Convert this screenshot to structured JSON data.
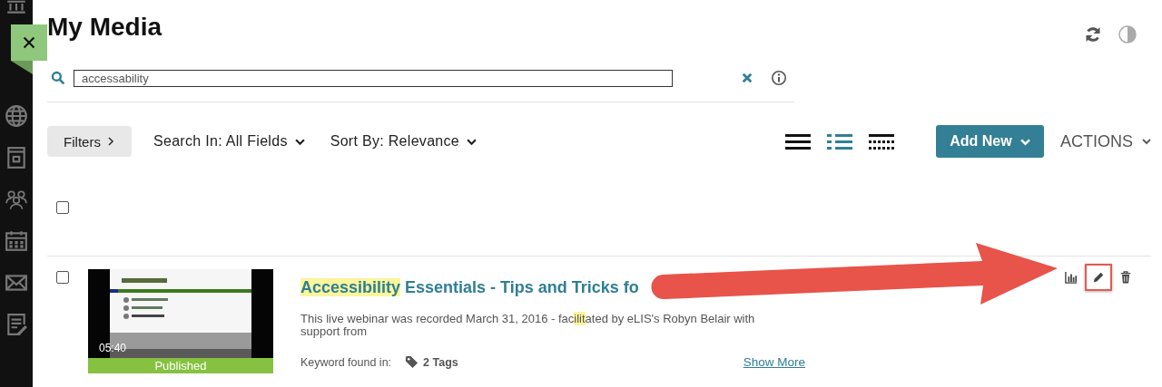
{
  "page_title": "My Media",
  "search": {
    "value": "accessability"
  },
  "filters_button": "Filters",
  "dropdowns": [
    {
      "label": "Search In: All Fields"
    },
    {
      "label": "Sort By: Relevance"
    }
  ],
  "view_modes": [
    {
      "kind": "details",
      "selected": false
    },
    {
      "kind": "list",
      "selected": true
    },
    {
      "kind": "table",
      "selected": false
    }
  ],
  "add_new_button": "Add New",
  "actions_menu": "ACTIONS",
  "select_all": {
    "checked": false
  },
  "entries": [
    {
      "checked": false,
      "duration": "05:40",
      "status": "Published",
      "title_highlight": "Accessibility",
      "title_rest": " Essentials - Tips and Tricks fo",
      "description": [
        {
          "text": "This live webinar was recorded March 31, 2016 - fac",
          "highlighted": false
        },
        {
          "text": "ilit",
          "highlighted": true
        },
        {
          "text": "ated by eLIS's Robyn Belair with support from",
          "highlighted": false
        }
      ],
      "keyword_label": "Keyword found in:",
      "tags": "2 Tags",
      "show_more": "Show More",
      "actions": [
        {
          "kind": "analytics",
          "highlighted": false
        },
        {
          "kind": "edit",
          "highlighted": true
        },
        {
          "kind": "delete",
          "highlighted": false
        }
      ]
    }
  ]
}
